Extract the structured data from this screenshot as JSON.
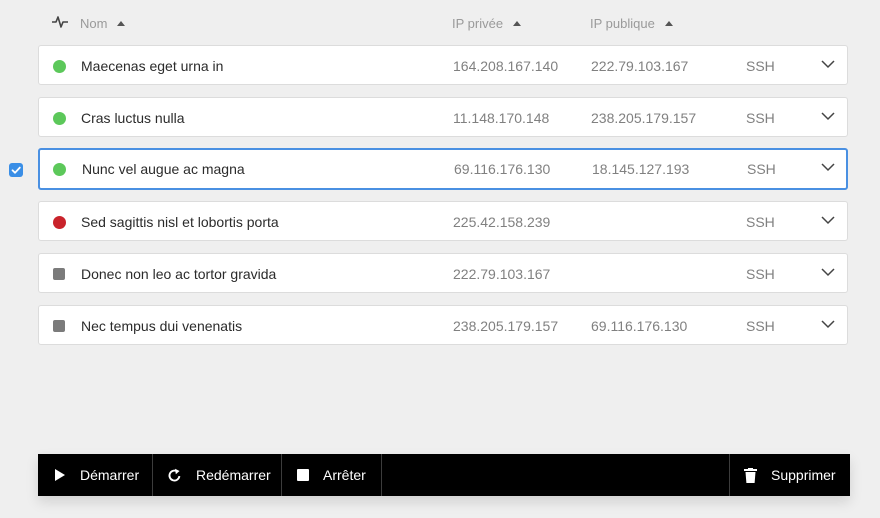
{
  "header": {
    "col_name": "Nom",
    "col_private_ip": "IP privée",
    "col_public_ip": "IP publique"
  },
  "rows": [
    {
      "name": "Maecenas eget urna in",
      "private_ip": "164.208.167.140",
      "public_ip": "222.79.103.167",
      "protocol": "SSH",
      "status": "running"
    },
    {
      "name": "Cras luctus nulla",
      "private_ip": "11.148.170.148",
      "public_ip": "238.205.179.157",
      "protocol": "SSH",
      "status": "running"
    },
    {
      "name": "Nunc vel augue ac magna",
      "private_ip": "69.116.176.130",
      "public_ip": "18.145.127.193",
      "protocol": "SSH",
      "status": "running",
      "selected": true
    },
    {
      "name": "Sed sagittis nisl et lobortis porta",
      "private_ip": "225.42.158.239",
      "public_ip": "",
      "protocol": "SSH",
      "status": "error"
    },
    {
      "name": "Donec non leo ac tortor gravida",
      "private_ip": "222.79.103.167",
      "public_ip": "",
      "protocol": "SSH",
      "status": "stopped"
    },
    {
      "name": "Nec tempus dui venenatis",
      "private_ip": "238.205.179.157",
      "public_ip": "69.116.176.130",
      "protocol": "SSH",
      "status": "stopped"
    }
  ],
  "toolbar": {
    "start_label": "Démarrer",
    "restart_label": "Redémarrer",
    "stop_label": "Arrêter",
    "delete_label": "Supprimer"
  },
  "icons": {
    "header": "activity-icon",
    "start": "play-icon",
    "restart": "refresh-icon",
    "stop": "stop-icon",
    "delete": "trash-icon",
    "row_expand": "chevron-down-icon",
    "selection": "checkbox-checked-icon"
  },
  "colors": {
    "running": "#5cc85a",
    "error": "#c9232b",
    "stopped": "#7b7b7b",
    "accent": "#4a90e2",
    "toolbar_bg": "#000000"
  }
}
